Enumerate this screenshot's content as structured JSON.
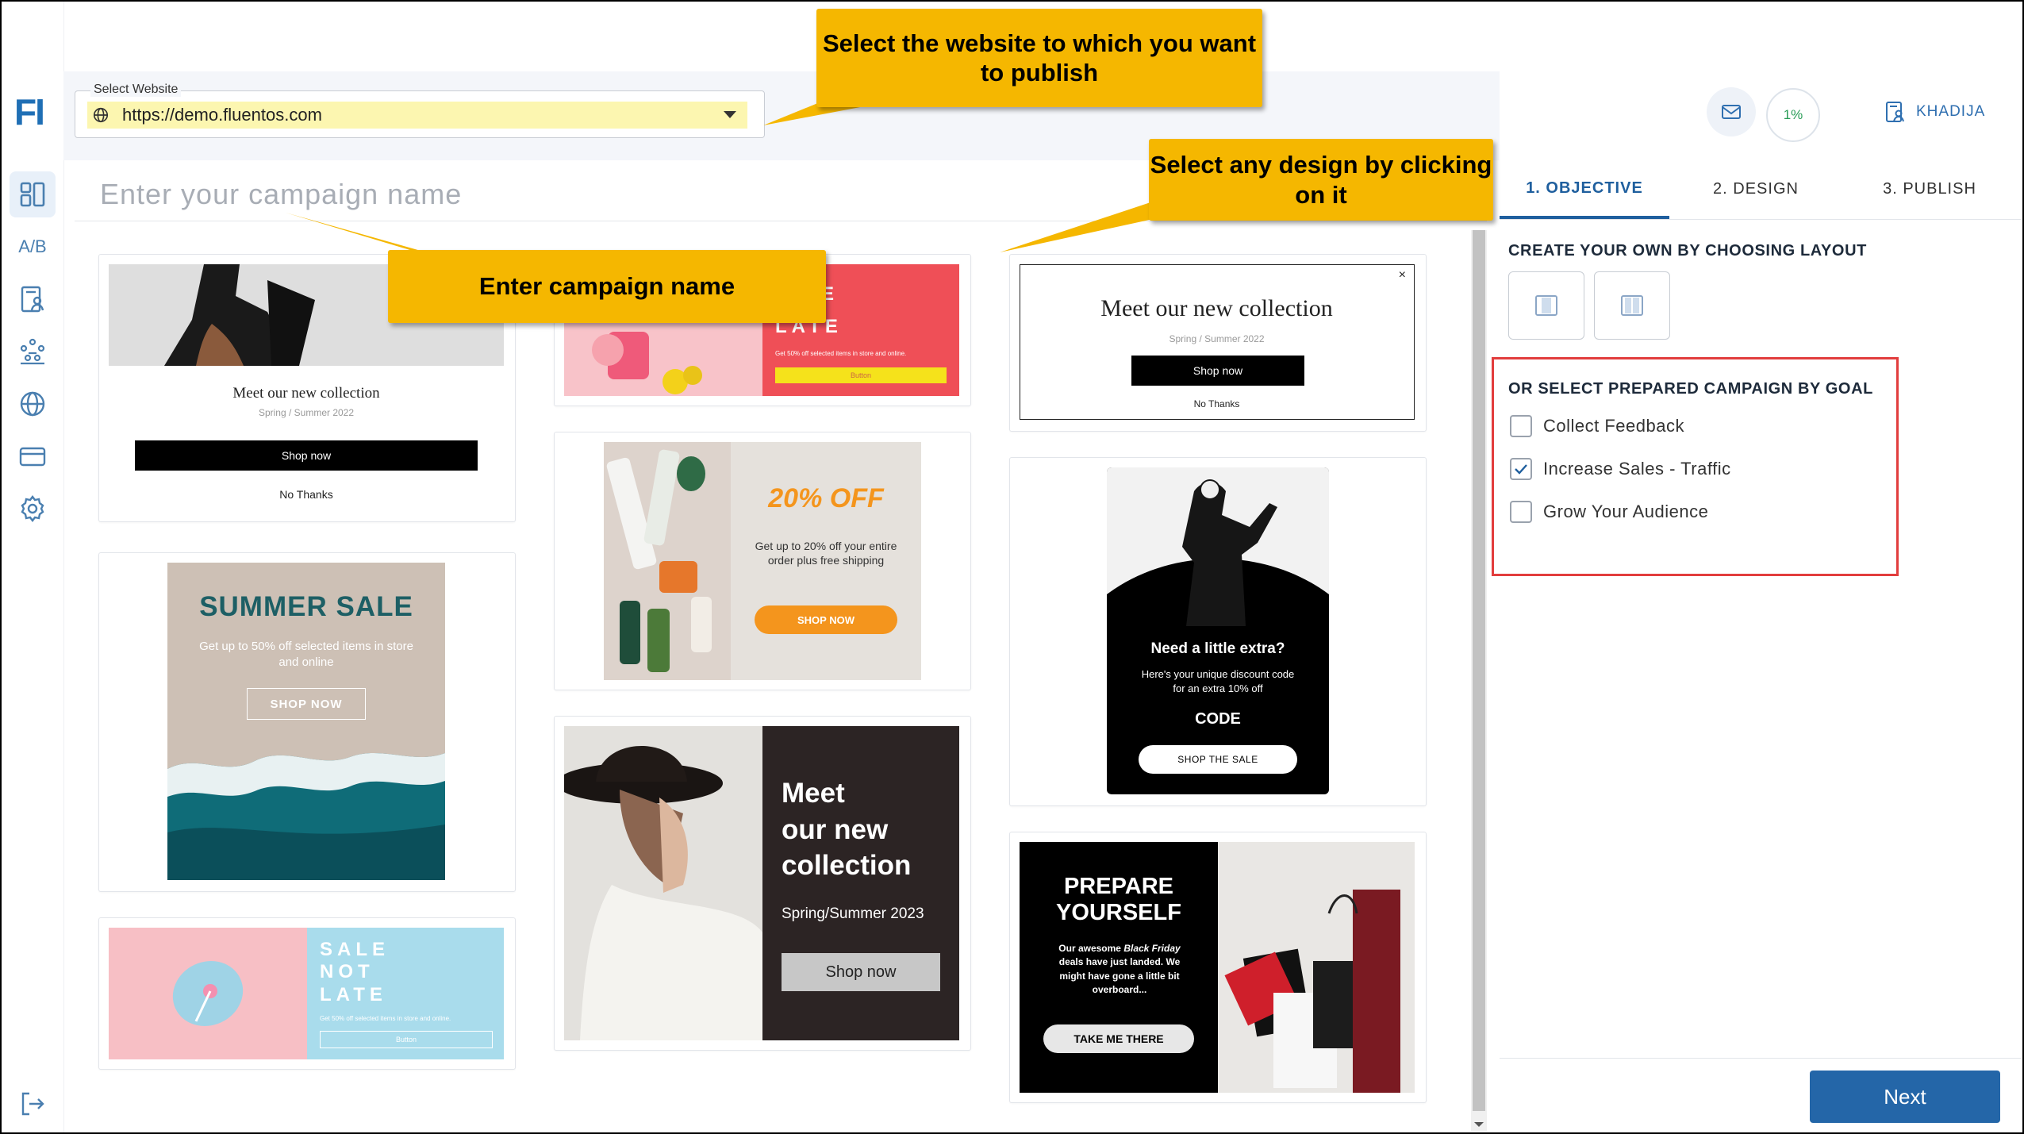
{
  "app": {
    "logo": "FI"
  },
  "rail": {
    "ab_label": "A/B"
  },
  "website_select": {
    "legend": "Select Website",
    "value": "https://demo.fluentos.com"
  },
  "header": {
    "progress": "1%",
    "user": "KHADIJA"
  },
  "campaign_name": {
    "placeholder": "Enter your campaign name"
  },
  "tabs": [
    {
      "label": "1. OBJECTIVE",
      "active": true
    },
    {
      "label": "2. DESIGN",
      "active": false
    },
    {
      "label": "3. PUBLISH",
      "active": false
    }
  ],
  "panel": {
    "layout_title": "CREATE YOUR OWN BY CHOOSING LAYOUT",
    "goal_title": "OR SELECT PREPARED CAMPAIGN BY GOAL",
    "goals": [
      {
        "label": "Collect Feedback",
        "checked": false
      },
      {
        "label": "Increase Sales - Traffic",
        "checked": true
      },
      {
        "label": "Grow Your Audience",
        "checked": false
      }
    ],
    "next": "Next"
  },
  "callouts": {
    "website": "Select the website to which you want to publish",
    "design": "Select any design by clicking on it",
    "name": "Enter campaign name"
  },
  "templates": {
    "t1": {
      "title": "Meet our new collection",
      "sub": "Spring / Summer 2022",
      "btn": "Shop now",
      "no": "No Thanks"
    },
    "t2": {
      "title": "SUMMER SALE",
      "sub": "Get up to 50% off selected items in store and online",
      "btn": "SHOP NOW"
    },
    "t3": {
      "l1": "SALE",
      "l2": "NOT",
      "l3": "LATE",
      "sub": "Get 50% off selected items in store and online.",
      "btn": "Button"
    },
    "t4": {
      "l1": "E",
      "l3": "LATE",
      "sub": "Get 50% off selected items in store and online.",
      "btn": "Button"
    },
    "t5": {
      "title": "20% OFF",
      "sub": "Get up to 20% off your entire order plus free shipping",
      "btn": "SHOP NOW"
    },
    "t6": {
      "l1": "Meet",
      "l2": "our new",
      "l3": "collection",
      "sub": "Spring/Summer 2023",
      "btn": "Shop now"
    },
    "t7": {
      "title": "Meet our new collection",
      "sub": "Spring / Summer 2022",
      "btn": "Shop now",
      "no": "No Thanks",
      "close": "×"
    },
    "t8": {
      "title": "Need a little extra?",
      "sub": "Here's your unique discount code for an extra 10% off",
      "code": "CODE",
      "btn": "SHOP THE SALE"
    },
    "t9": {
      "l1": "PREPARE",
      "l2": "YOURSELF",
      "sub_a": "Our awesome",
      "sub_b": "Black Friday",
      "sub_c": "deals have just landed. We might have gone a little bit overboard...",
      "btn": "TAKE ME THERE"
    }
  },
  "colors": {
    "accent": "#2466a8",
    "callout": "#f5b700",
    "highlight_border": "#e23d3d",
    "field_highlight": "#fcf6b0"
  }
}
